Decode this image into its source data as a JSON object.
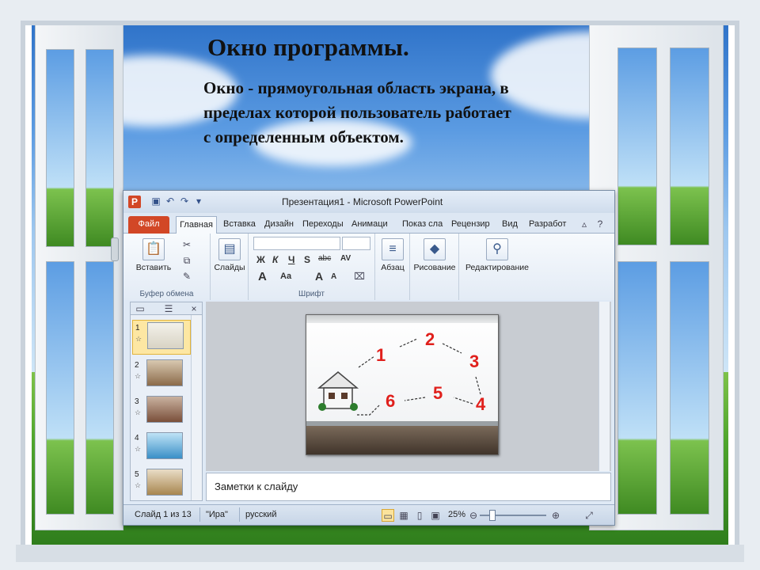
{
  "slide_title": "Окно программы.",
  "definition": "Окно - прямоугольная область экрана, в пределах которой пользователь работает с определенным объектом.",
  "window": {
    "title": "Презентация1 - Microsoft PowerPoint",
    "app_icon": "P"
  },
  "tabs": [
    "Файл",
    "Главная",
    "Вставка",
    "Дизайн",
    "Переходы",
    "Анимаци",
    "Показ сла",
    "Рецензир",
    "Вид",
    "Разработ"
  ],
  "ribbon": {
    "paste_label": "Вставить",
    "clipboard_group": "Буфер обмена",
    "slides_label": "Слайды",
    "font_group": "Шрифт",
    "paragraph_label": "Абзац",
    "drawing_label": "Рисование",
    "editing_label": "Редактирование",
    "bold": "Ж",
    "italic": "К",
    "underline": "Ч",
    "strike": "S",
    "abc": "abc",
    "grow": "A",
    "shrink": "A",
    "aa": "Aa",
    "spacing": "AV"
  },
  "thumbnails": [
    "1",
    "2",
    "3",
    "4",
    "5"
  ],
  "slide_numbers": [
    "1",
    "2",
    "3",
    "4",
    "5",
    "6"
  ],
  "notes_placeholder": "Заметки к слайду",
  "status": {
    "slide_info": "Слайд 1 из 13",
    "theme": "\"Ира\"",
    "language": "русский",
    "zoom": "25%"
  },
  "colors": {
    "file_tab": "#d24726",
    "slide_number_red": "#e0201c"
  }
}
